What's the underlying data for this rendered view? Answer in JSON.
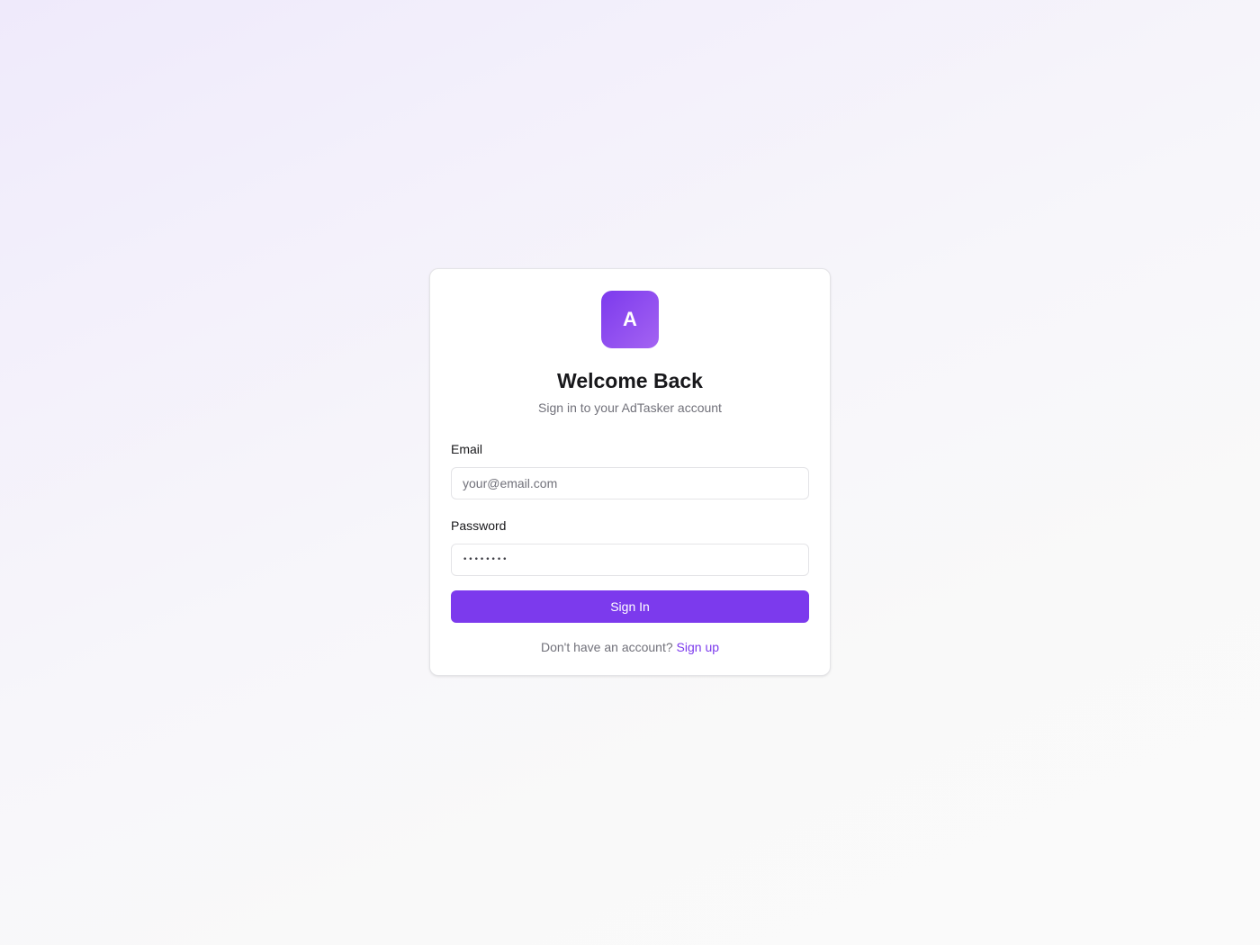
{
  "brand": {
    "logo_letter": "A",
    "accent_color": "#7c3aed"
  },
  "login": {
    "title": "Welcome Back",
    "subtitle": "Sign in to your AdTasker account",
    "email": {
      "label": "Email",
      "placeholder": "your@email.com",
      "value": ""
    },
    "password": {
      "label": "Password",
      "value": "••••••••"
    },
    "submit_label": "Sign In",
    "footer_text": "Don't have an account?",
    "signup_link": "Sign up"
  }
}
